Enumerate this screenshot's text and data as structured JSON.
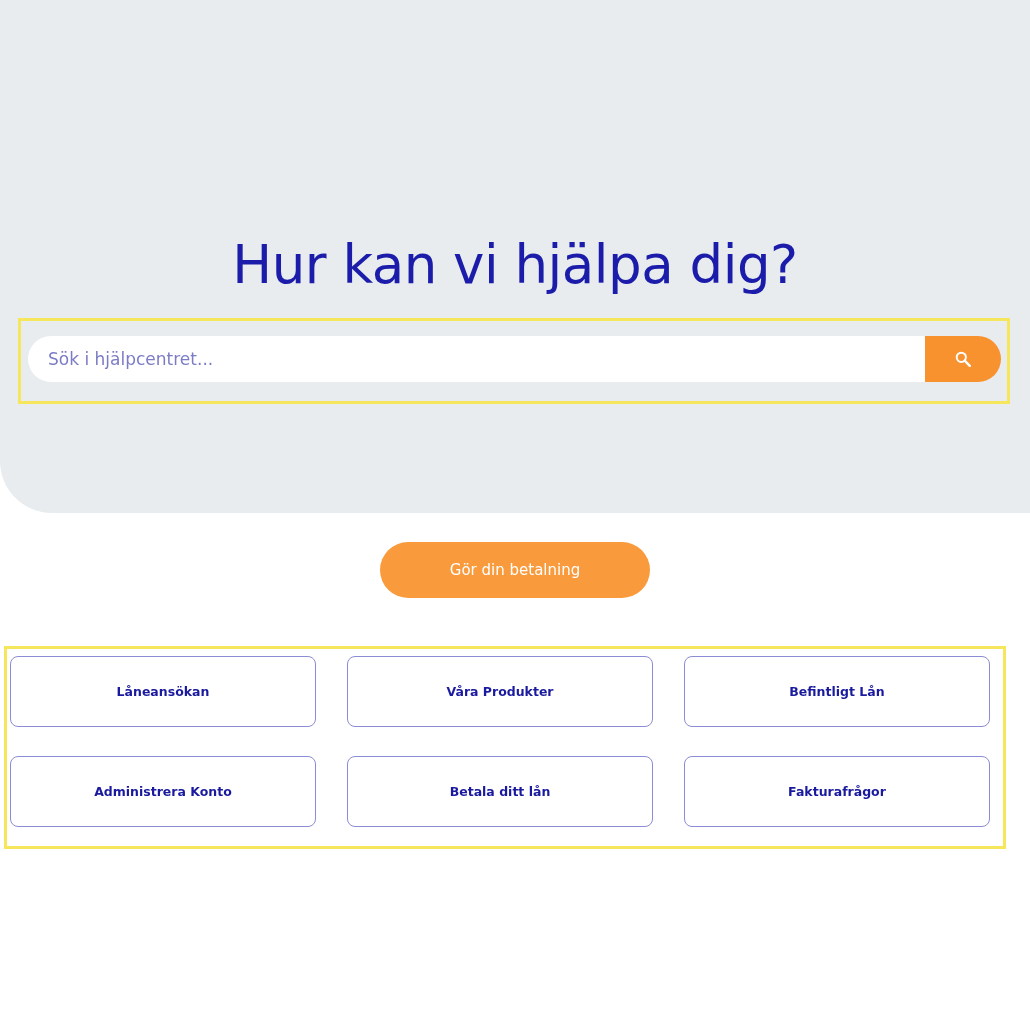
{
  "hero": {
    "title": "Hur kan vi hjälpa dig?",
    "search": {
      "placeholder": "Sök i hjälpcentret..."
    }
  },
  "payment_button": {
    "label": "Gör din betalning"
  },
  "categories": [
    {
      "label": "Låneansökan"
    },
    {
      "label": "Våra Produkter"
    },
    {
      "label": "Befintligt Lån"
    },
    {
      "label": "Administrera Konto"
    },
    {
      "label": "Betala ditt lån"
    },
    {
      "label": "Fakturafrågor"
    }
  ]
}
